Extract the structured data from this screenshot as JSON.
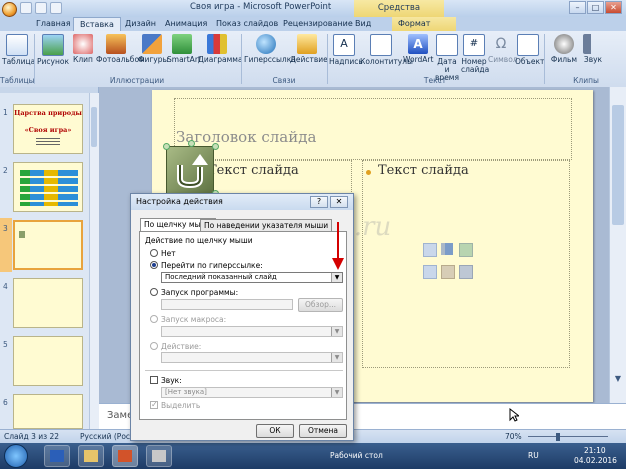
{
  "window": {
    "app_title": "Своя игра - Microsoft PowerPoint",
    "context_title": "Средства рисования",
    "controls": [
      "–",
      "□",
      "✕"
    ]
  },
  "ribbon": {
    "tabs": [
      "Главная",
      "Вставка",
      "Дизайн",
      "Анимация",
      "Показ слайдов",
      "Рецензирование",
      "Вид",
      "Формат"
    ],
    "active_tab": "Вставка",
    "buttons": {
      "table": "Таблица",
      "picture": "Рисунок",
      "clip": "Клип",
      "photoalbum": "Фотоальбом",
      "shapes": "Фигуры",
      "smartart": "SmartArt",
      "chart": "Диаграмма",
      "hyperlink": "Гиперссылка",
      "action": "Действие",
      "textbox": "Надпись",
      "header_footer": "Колонтитулы",
      "wordart": "WordArt",
      "date_time_1": "Дата и",
      "date_time_2": "время",
      "slide_number_1": "Номер",
      "slide_number_2": "слайда",
      "symbol": "Символ",
      "object": "Объект",
      "movie": "Фильм",
      "sound": "Звук"
    },
    "groups": {
      "tables": "Таблицы",
      "illustrations": "Иллюстрации",
      "links": "Связи",
      "text": "Текст",
      "media": "Клипы мультимедиа"
    }
  },
  "slides_pane": {
    "numbers": [
      "1",
      "2",
      "3",
      "4",
      "5",
      "6"
    ],
    "thumb1_title": "Царства природы",
    "thumb1_subtitle": "«Своя игра»"
  },
  "slide": {
    "title_placeholder": "Заголовок слайда",
    "content_left": "Текст слайда",
    "content_right": "Текст слайда",
    "watermark": "kladraz.ru"
  },
  "notes": {
    "placeholder": "Заметки к слайду"
  },
  "statusbar": {
    "slide_info": "Слайд 3 из 22",
    "language": "Русский (Россия)",
    "zoom": "70%"
  },
  "taskbar": {
    "desktop_label": "Рабочий стол",
    "lang": "RU",
    "time": "21:10",
    "date": "04.02.2016"
  },
  "dialog": {
    "title": "Настройка действия",
    "help": "?",
    "close": "✕",
    "tab_click": "По щелчку мыши",
    "tab_hover": "По наведении указателя мыши",
    "group_label": "Действие по щелчку мыши",
    "opt_none": "Нет",
    "opt_hyperlink": "Перейти по гиперссылке:",
    "hyperlink_value": "Последний показанный слайд",
    "opt_run_program": "Запуск программы:",
    "browse": "Обзор...",
    "opt_run_macro": "Запуск макроса:",
    "opt_action": "Действие:",
    "sound_label": "Звук:",
    "sound_value": "[Нет звука]",
    "highlight_label": "Выделить",
    "ok": "ОК",
    "cancel": "Отмена"
  },
  "colors": {
    "slide_bg": "#fffbd2",
    "ribbon_bg": "#dbe6f4",
    "dialog_bg": "#f0f0f0",
    "annotation_arrow": "#d40000",
    "action_button": "#8a9f6a"
  }
}
